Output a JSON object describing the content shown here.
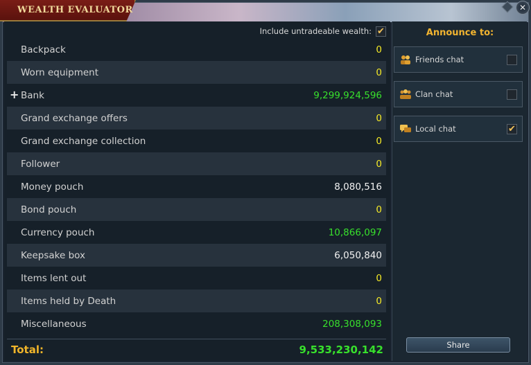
{
  "window": {
    "title": "WEALTH EVALUATOR",
    "close_label": "✕"
  },
  "untradeable": {
    "label": "Include untradeable wealth:",
    "checked": true,
    "check_glyph": "✔"
  },
  "rows": [
    {
      "label": "Backpack",
      "value": "0",
      "color": "yellow"
    },
    {
      "label": "Worn equipment",
      "value": "0",
      "color": "yellow"
    },
    {
      "label": "Bank",
      "value": "9,299,924,596",
      "color": "green",
      "expandable": true,
      "expand_glyph": "+"
    },
    {
      "label": "Grand exchange offers",
      "value": "0",
      "color": "yellow"
    },
    {
      "label": "Grand exchange collection",
      "value": "0",
      "color": "yellow"
    },
    {
      "label": "Follower",
      "value": "0",
      "color": "yellow"
    },
    {
      "label": "Money pouch",
      "value": "8,080,516",
      "color": "white"
    },
    {
      "label": "Bond pouch",
      "value": "0",
      "color": "yellow"
    },
    {
      "label": "Currency pouch",
      "value": "10,866,097",
      "color": "green"
    },
    {
      "label": "Keepsake box",
      "value": "6,050,840",
      "color": "white"
    },
    {
      "label": "Items lent out",
      "value": "0",
      "color": "yellow"
    },
    {
      "label": "Items held by Death",
      "value": "0",
      "color": "yellow"
    },
    {
      "label": "Miscellaneous",
      "value": "208,308,093",
      "color": "green"
    }
  ],
  "total": {
    "label": "Total:",
    "value": "9,533,230,142"
  },
  "announce": {
    "heading": "Announce to:",
    "options": [
      {
        "label": "Friends chat",
        "icon": "friends-icon",
        "checked": false
      },
      {
        "label": "Clan chat",
        "icon": "clan-icon",
        "checked": false
      },
      {
        "label": "Local chat",
        "icon": "local-chat-icon",
        "checked": true
      }
    ],
    "check_glyph": "✔",
    "share_label": "Share"
  },
  "colors": {
    "yellow": "#f5ea26",
    "green": "#38e02c",
    "white": "#f2f2f2",
    "accent": "#f2b430"
  }
}
